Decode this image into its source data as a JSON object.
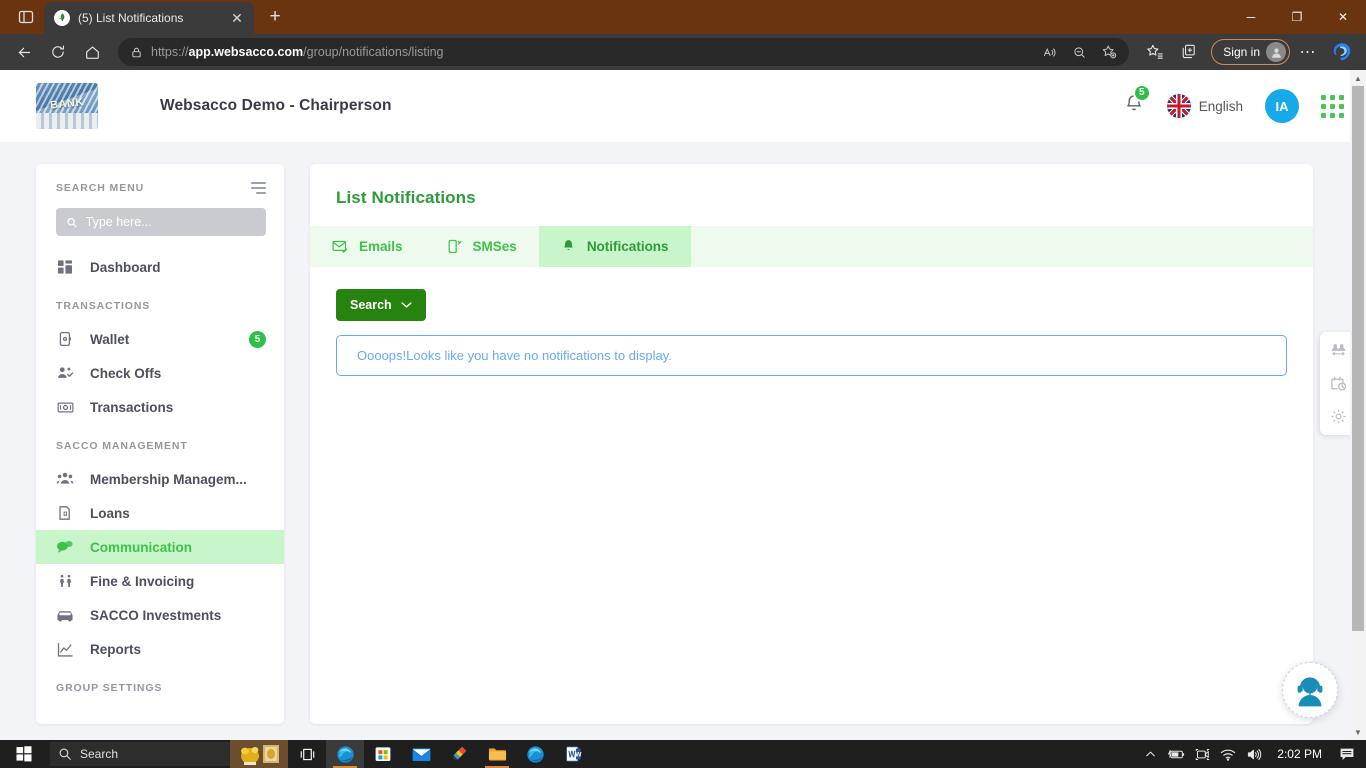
{
  "browser": {
    "tab": {
      "title": "(5) List Notifications",
      "favicon_name": "websacco-favicon",
      "close_label": "✕"
    },
    "newtab_label": "+",
    "tablist_button": "tab-actions",
    "window_controls": {
      "minimize": "─",
      "maximize": "❐",
      "close": "✕"
    },
    "nav": {
      "back": "←",
      "refresh": "↻",
      "home": "⌂"
    },
    "address": {
      "scheme": "https://",
      "host": "app.websacco.com",
      "path": "/group/notifications/listing",
      "lock_icon": "lock-icon"
    },
    "omni_actions": [
      "read-aloud-icon",
      "zoom-out-icon",
      "add-favorite-icon"
    ],
    "toolbar_actions": [
      "favorites-icon",
      "collections-icon"
    ],
    "signin_label": "Sign in",
    "settings_label": "⋯",
    "copilot_label": "b"
  },
  "topbar": {
    "logo_word": "BANK",
    "title": "Websacco Demo - Chairperson",
    "notification_count": "5",
    "language": "English",
    "user_initials": "IA"
  },
  "sidebar": {
    "search_header": "SEARCH MENU",
    "search_placeholder": "Type here...",
    "search_value": "",
    "items": [
      {
        "label": "Dashboard",
        "icon": "dashboard-icon",
        "section": null,
        "active": false,
        "badge": null
      },
      {
        "label": "Wallet",
        "icon": "wallet-icon",
        "section": "TRANSACTIONS",
        "active": false,
        "badge": "5"
      },
      {
        "label": "Check Offs",
        "icon": "user-check-icon",
        "section": null,
        "active": false,
        "badge": null
      },
      {
        "label": "Transactions",
        "icon": "cash-icon",
        "section": null,
        "active": false,
        "badge": null
      },
      {
        "label": "Membership Managem...",
        "icon": "people-icon",
        "section": "SACCO MANAGEMENT",
        "active": false,
        "badge": null
      },
      {
        "label": "Loans",
        "icon": "loan-icon",
        "section": null,
        "active": false,
        "badge": null
      },
      {
        "label": "Communication",
        "icon": "chat-icon",
        "section": null,
        "active": true,
        "badge": null
      },
      {
        "label": "Fine & Invoicing",
        "icon": "fine-icon",
        "section": null,
        "active": false,
        "badge": null
      },
      {
        "label": "SACCO Investments",
        "icon": "car-icon",
        "section": null,
        "active": false,
        "badge": null
      },
      {
        "label": "Reports",
        "icon": "chart-icon",
        "section": null,
        "active": false,
        "badge": null
      }
    ],
    "sections": {
      "transactions": "TRANSACTIONS",
      "sacco_management": "SACCO MANAGEMENT",
      "group_settings": "GROUP SETTINGS"
    }
  },
  "main": {
    "page_title": "List Notifications",
    "tabs": [
      {
        "label": "Emails",
        "icon": "mail-check-icon",
        "active": false
      },
      {
        "label": "SMSes",
        "icon": "mobile-icon",
        "active": false
      },
      {
        "label": "Notifications",
        "icon": "bell-icon",
        "active": true
      }
    ],
    "search_button": "Search",
    "search_button_caret": "chevron-down-icon",
    "empty_message": "Oooops!Looks like you have no notifications to display."
  },
  "right_rail": {
    "items": [
      {
        "icon": "members-icon"
      },
      {
        "icon": "calendar-clock-icon"
      },
      {
        "icon": "gear-icon"
      }
    ]
  },
  "support_widget": {
    "icon": "headset-support-icon"
  },
  "taskbar": {
    "start": "windows-logo-icon",
    "search_placeholder": "Search",
    "items": [
      {
        "icon": "widgets-weather-icon",
        "name": "widgets"
      },
      {
        "icon": "task-view-icon",
        "name": "task-view"
      },
      {
        "icon": "edge-icon",
        "name": "microsoft-edge"
      },
      {
        "icon": "microsoft-store-icon",
        "name": "microsoft-store"
      },
      {
        "icon": "mail-icon",
        "name": "mail"
      },
      {
        "icon": "paint-icon",
        "name": "paint"
      },
      {
        "icon": "file-explorer-icon",
        "name": "file-explorer"
      },
      {
        "icon": "edge-icon",
        "name": "microsoft-edge-2"
      },
      {
        "icon": "word-icon",
        "name": "microsoft-word"
      }
    ],
    "tray": [
      "chevron-up-icon",
      "battery-charging-icon",
      "camera-icon",
      "wifi-icon",
      "volume-icon"
    ],
    "clock": "2:02 PM",
    "notification_center": "notification-center-icon"
  },
  "colors": {
    "brand_green": "#3fc14a",
    "title_green": "#2e9b38",
    "active_bg": "#c9f5ca",
    "tabs_bg": "#eefaee",
    "search_btn": "#26830f",
    "info_blue": "#6aa9f2",
    "avatar_blue": "#18a9e8",
    "browser_chrome": "#6b3410"
  }
}
